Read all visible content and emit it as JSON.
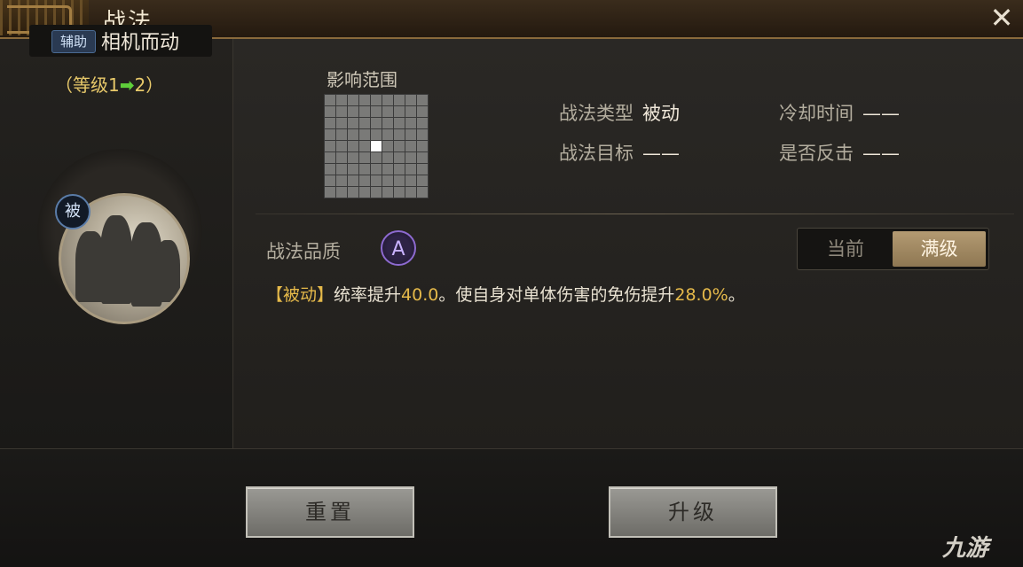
{
  "window": {
    "title": "战法"
  },
  "left": {
    "tag": "辅助",
    "skill_name": "相机而动",
    "level_prefix": "（等级1",
    "level_arrow": "➡",
    "level_suffix": "2）",
    "passive_badge": "被"
  },
  "range": {
    "label": "影响范围",
    "grid_size": 9,
    "active_cells": [
      [
        4,
        4
      ]
    ]
  },
  "info": {
    "type_label": "战法类型",
    "type_value": "被动",
    "cooldown_label": "冷却时间",
    "cooldown_value": "——",
    "target_label": "战法目标",
    "target_value": "——",
    "counter_label": "是否反击",
    "counter_value": "——"
  },
  "quality": {
    "label": "战法品质",
    "grade": "A"
  },
  "toggle": {
    "current": "当前",
    "max": "满级",
    "selected": "满级"
  },
  "description": {
    "part1": "【被动】统率提升",
    "value1": "40.0",
    "part2": "。使自身对单体伤害的免伤提升",
    "value2": "28.0%",
    "part3": "。"
  },
  "buttons": {
    "reset": "重置",
    "upgrade": "升级"
  },
  "watermark": "九游",
  "colors": {
    "highlight": "#e5b94a",
    "level_text": "#e8c96a",
    "arrow": "#5fcf3a",
    "quality_purple": "#8d6ad0"
  }
}
